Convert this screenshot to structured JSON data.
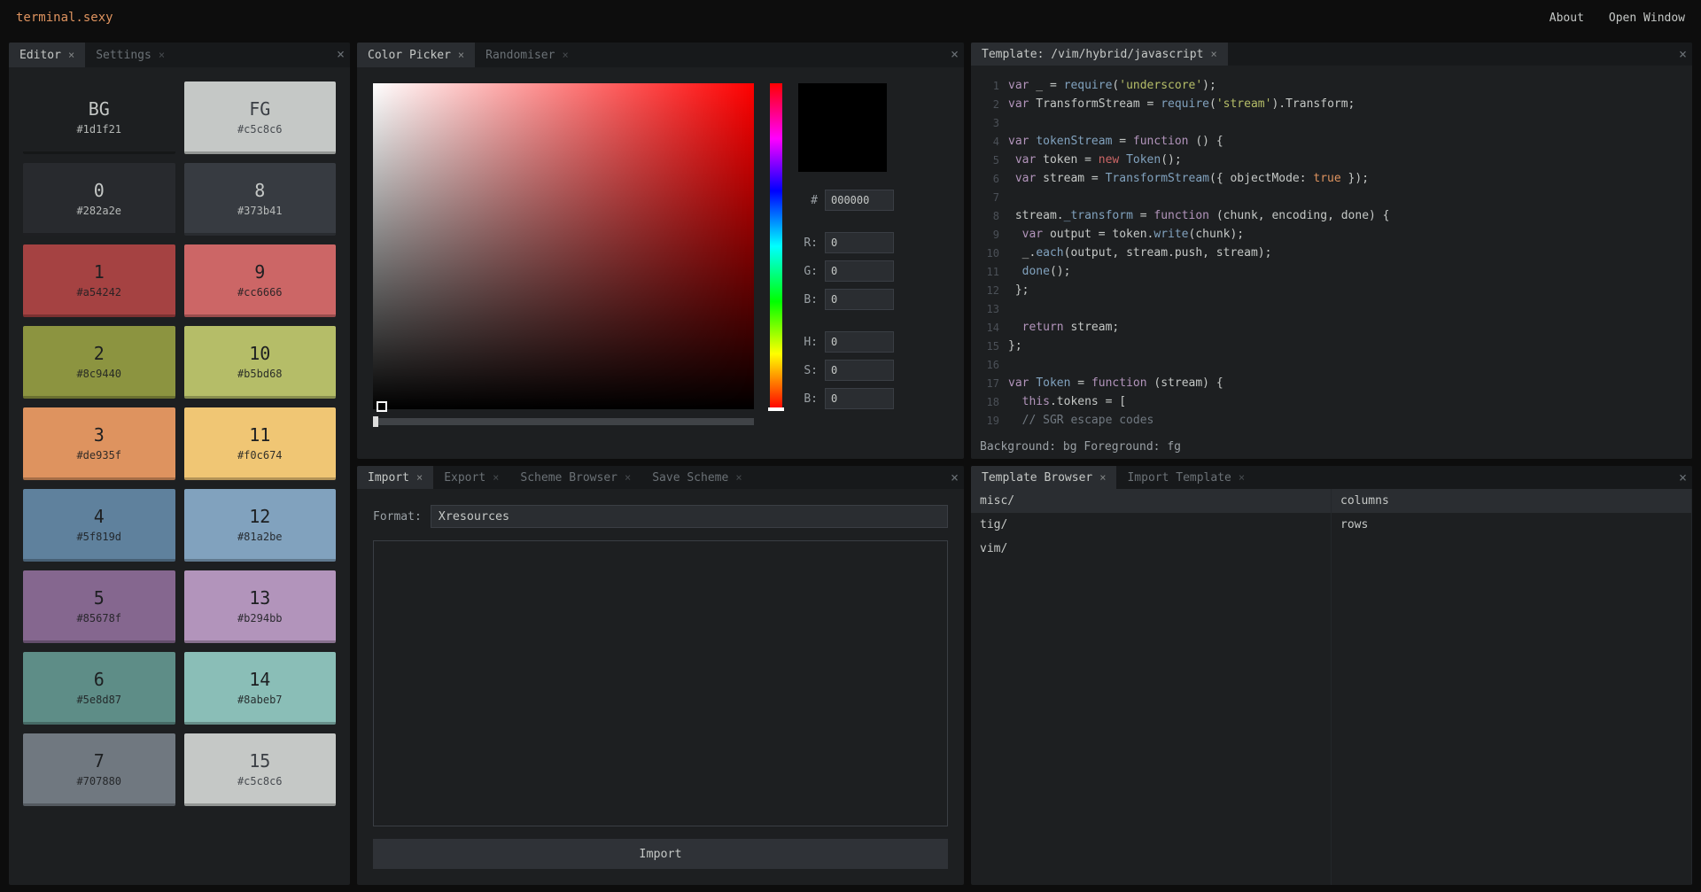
{
  "app": {
    "logo": "terminal.sexy"
  },
  "header": {
    "about": "About",
    "open_window": "Open Window"
  },
  "editor_panel": {
    "tabs": [
      {
        "label": "Editor",
        "active": true
      },
      {
        "label": "Settings",
        "active": false
      }
    ],
    "swatches": [
      {
        "name": "BG",
        "hex": "#1d1f21",
        "fg": "#c5c8c6"
      },
      {
        "name": "FG",
        "hex": "#c5c8c6",
        "fg": "#3a3e44"
      },
      {
        "name": "0",
        "hex": "#282a2e",
        "fg": "#c5c8c6"
      },
      {
        "name": "8",
        "hex": "#373b41",
        "fg": "#c5c8c6"
      },
      {
        "name": "1",
        "hex": "#a54242",
        "fg": "#1d1f21"
      },
      {
        "name": "9",
        "hex": "#cc6666",
        "fg": "#1d1f21"
      },
      {
        "name": "2",
        "hex": "#8c9440",
        "fg": "#1d1f21"
      },
      {
        "name": "10",
        "hex": "#b5bd68",
        "fg": "#1d1f21"
      },
      {
        "name": "3",
        "hex": "#de935f",
        "fg": "#1d1f21"
      },
      {
        "name": "11",
        "hex": "#f0c674",
        "fg": "#1d1f21"
      },
      {
        "name": "4",
        "hex": "#5f819d",
        "fg": "#1d1f21"
      },
      {
        "name": "12",
        "hex": "#81a2be",
        "fg": "#1d1f21"
      },
      {
        "name": "5",
        "hex": "#85678f",
        "fg": "#1d1f21"
      },
      {
        "name": "13",
        "hex": "#b294bb",
        "fg": "#1d1f21"
      },
      {
        "name": "6",
        "hex": "#5e8d87",
        "fg": "#1d1f21"
      },
      {
        "name": "14",
        "hex": "#8abeb7",
        "fg": "#1d1f21"
      },
      {
        "name": "7",
        "hex": "#707880",
        "fg": "#1d1f21"
      },
      {
        "name": "15",
        "hex": "#c5c8c6",
        "fg": "#3a3e44"
      }
    ]
  },
  "picker_panel": {
    "tabs": [
      {
        "label": "Color Picker",
        "active": true
      },
      {
        "label": "Randomiser",
        "active": false
      }
    ],
    "hex_label": "#",
    "hex": "000000",
    "rgb": {
      "r_label": "R:",
      "g_label": "G:",
      "b_label": "B:",
      "r": "0",
      "g": "0",
      "b": "0"
    },
    "hsb": {
      "h_label": "H:",
      "s_label": "S:",
      "b_label": "B:",
      "h": "0",
      "s": "0",
      "b": "0"
    }
  },
  "import_panel": {
    "tabs": [
      {
        "label": "Import",
        "active": true
      },
      {
        "label": "Export",
        "active": false
      },
      {
        "label": "Scheme Browser",
        "active": false
      },
      {
        "label": "Save Scheme",
        "active": false
      }
    ],
    "format_label": "Format:",
    "format_value": "Xresources",
    "button": "Import"
  },
  "template_panel": {
    "tab_label": "Template: /vim/hybrid/javascript",
    "status": "Background: bg Foreground: fg",
    "code": [
      {
        "n": "1",
        "tokens": [
          [
            "kw",
            "var"
          ],
          [
            "ident",
            " _ "
          ],
          [
            "ident",
            "= "
          ],
          [
            "fn",
            "require"
          ],
          [
            "ident",
            "("
          ],
          [
            "str",
            "'underscore'"
          ],
          [
            "ident",
            ");"
          ]
        ]
      },
      {
        "n": "2",
        "tokens": [
          [
            "kw",
            "var"
          ],
          [
            "ident",
            " TransformStream = "
          ],
          [
            "fn",
            "require"
          ],
          [
            "ident",
            "("
          ],
          [
            "str",
            "'stream'"
          ],
          [
            "ident",
            ").Transform;"
          ]
        ]
      },
      {
        "n": "3",
        "tokens": []
      },
      {
        "n": "4",
        "tokens": [
          [
            "kw",
            "var"
          ],
          [
            "ident",
            " "
          ],
          [
            "fn",
            "tokenStream"
          ],
          [
            "ident",
            " = "
          ],
          [
            "kw",
            "function"
          ],
          [
            "ident",
            " () {"
          ]
        ]
      },
      {
        "n": "5",
        "tokens": [
          [
            "ident",
            " "
          ],
          [
            "kw",
            "var"
          ],
          [
            "ident",
            " token = "
          ],
          [
            "new",
            "new"
          ],
          [
            "ident",
            " "
          ],
          [
            "fn",
            "Token"
          ],
          [
            "ident",
            "();"
          ]
        ]
      },
      {
        "n": "6",
        "tokens": [
          [
            "ident",
            " "
          ],
          [
            "kw",
            "var"
          ],
          [
            "ident",
            " stream = "
          ],
          [
            "fn",
            "TransformStream"
          ],
          [
            "ident",
            "({ objectMode: "
          ],
          [
            "const",
            "true"
          ],
          [
            "ident",
            " });"
          ]
        ]
      },
      {
        "n": "7",
        "tokens": []
      },
      {
        "n": "8",
        "tokens": [
          [
            "ident",
            " stream."
          ],
          [
            "fn",
            "_transform"
          ],
          [
            "ident",
            " = "
          ],
          [
            "kw",
            "function"
          ],
          [
            "ident",
            " (chunk, encoding, done) {"
          ]
        ]
      },
      {
        "n": "9",
        "tokens": [
          [
            "ident",
            "  "
          ],
          [
            "kw",
            "var"
          ],
          [
            "ident",
            " output = token."
          ],
          [
            "fn",
            "write"
          ],
          [
            "ident",
            "(chunk);"
          ]
        ]
      },
      {
        "n": "10",
        "tokens": [
          [
            "ident",
            "  _."
          ],
          [
            "fn",
            "each"
          ],
          [
            "ident",
            "(output, stream.push, stream);"
          ]
        ]
      },
      {
        "n": "11",
        "tokens": [
          [
            "ident",
            "  "
          ],
          [
            "fn",
            "done"
          ],
          [
            "ident",
            "();"
          ]
        ]
      },
      {
        "n": "12",
        "tokens": [
          [
            "ident",
            " };"
          ]
        ]
      },
      {
        "n": "13",
        "tokens": []
      },
      {
        "n": "14",
        "tokens": [
          [
            "ident",
            "  "
          ],
          [
            "kw",
            "return"
          ],
          [
            "ident",
            " stream;"
          ]
        ]
      },
      {
        "n": "15",
        "tokens": [
          [
            "ident",
            "};"
          ]
        ]
      },
      {
        "n": "16",
        "tokens": []
      },
      {
        "n": "17",
        "tokens": [
          [
            "kw",
            "var"
          ],
          [
            "ident",
            " "
          ],
          [
            "fn",
            "Token"
          ],
          [
            "ident",
            " = "
          ],
          [
            "kw",
            "function"
          ],
          [
            "ident",
            " (stream) {"
          ]
        ]
      },
      {
        "n": "18",
        "tokens": [
          [
            "ident",
            "  "
          ],
          [
            "kw",
            "this"
          ],
          [
            "ident",
            ".tokens = ["
          ]
        ]
      },
      {
        "n": "19",
        "tokens": [
          [
            "ident",
            "  "
          ],
          [
            "cmt",
            "// SGR escape codes"
          ]
        ]
      }
    ]
  },
  "template_browser": {
    "tabs": [
      {
        "label": "Template Browser",
        "active": true
      },
      {
        "label": "Import Template",
        "active": false
      }
    ],
    "col1": [
      {
        "label": "misc/",
        "sel": true
      },
      {
        "label": "tig/",
        "sel": false
      },
      {
        "label": "vim/",
        "sel": false
      }
    ],
    "col2": [
      {
        "label": "columns",
        "sel": true
      },
      {
        "label": "rows",
        "sel": false
      }
    ]
  }
}
